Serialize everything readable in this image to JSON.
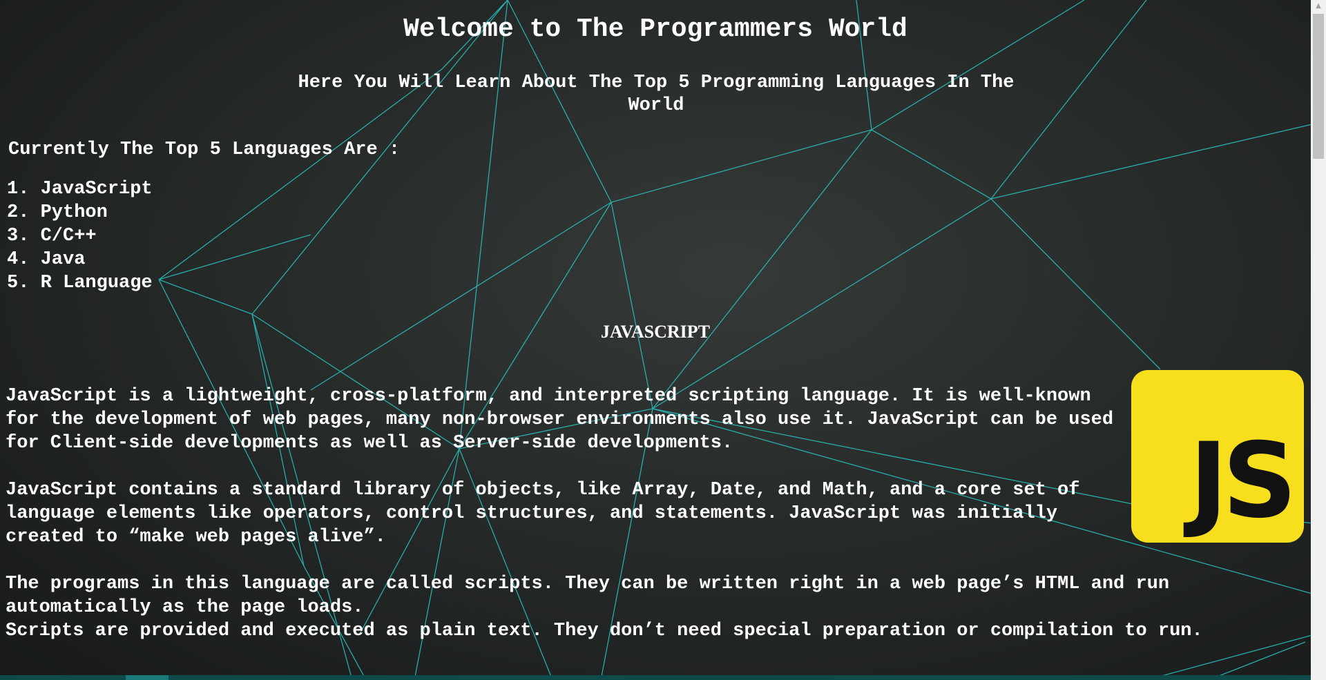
{
  "page": {
    "title": "Welcome to The Programmers World",
    "subtitle": "Here You Will Learn About The Top 5 Programming Languages In The World",
    "intro": "Currently The Top 5 Languages Are :"
  },
  "languages": [
    "1. JavaScript",
    "2. Python",
    "3. C/C++",
    "4. Java",
    "5. R Language"
  ],
  "section": {
    "heading": "JAVASCRIPT",
    "paragraphs": [
      "JavaScript is a lightweight, cross-platform, and interpreted scripting language. It is well-known for the development of web pages, many non-browser environments also use it. JavaScript can be used for Client-side developments as well as Server-side developments.",
      "JavaScript contains a standard library of objects, like Array, Date, and Math, and a core set of language elements like operators, control structures, and statements. JavaScript was initially created to “make web pages alive”.",
      "The programs in this language are called scripts. They can be written right in a web page’s HTML and run automatically as the page loads.\nScripts are provided and executed as plain text. They don’t need special preparation or compilation to run."
    ],
    "logo_text": "JS"
  },
  "colors": {
    "background": "#262a29",
    "network_lines": "#2ac4c0",
    "text": "#ffffff",
    "logo_background": "#f7df1e",
    "logo_text": "#111111"
  }
}
